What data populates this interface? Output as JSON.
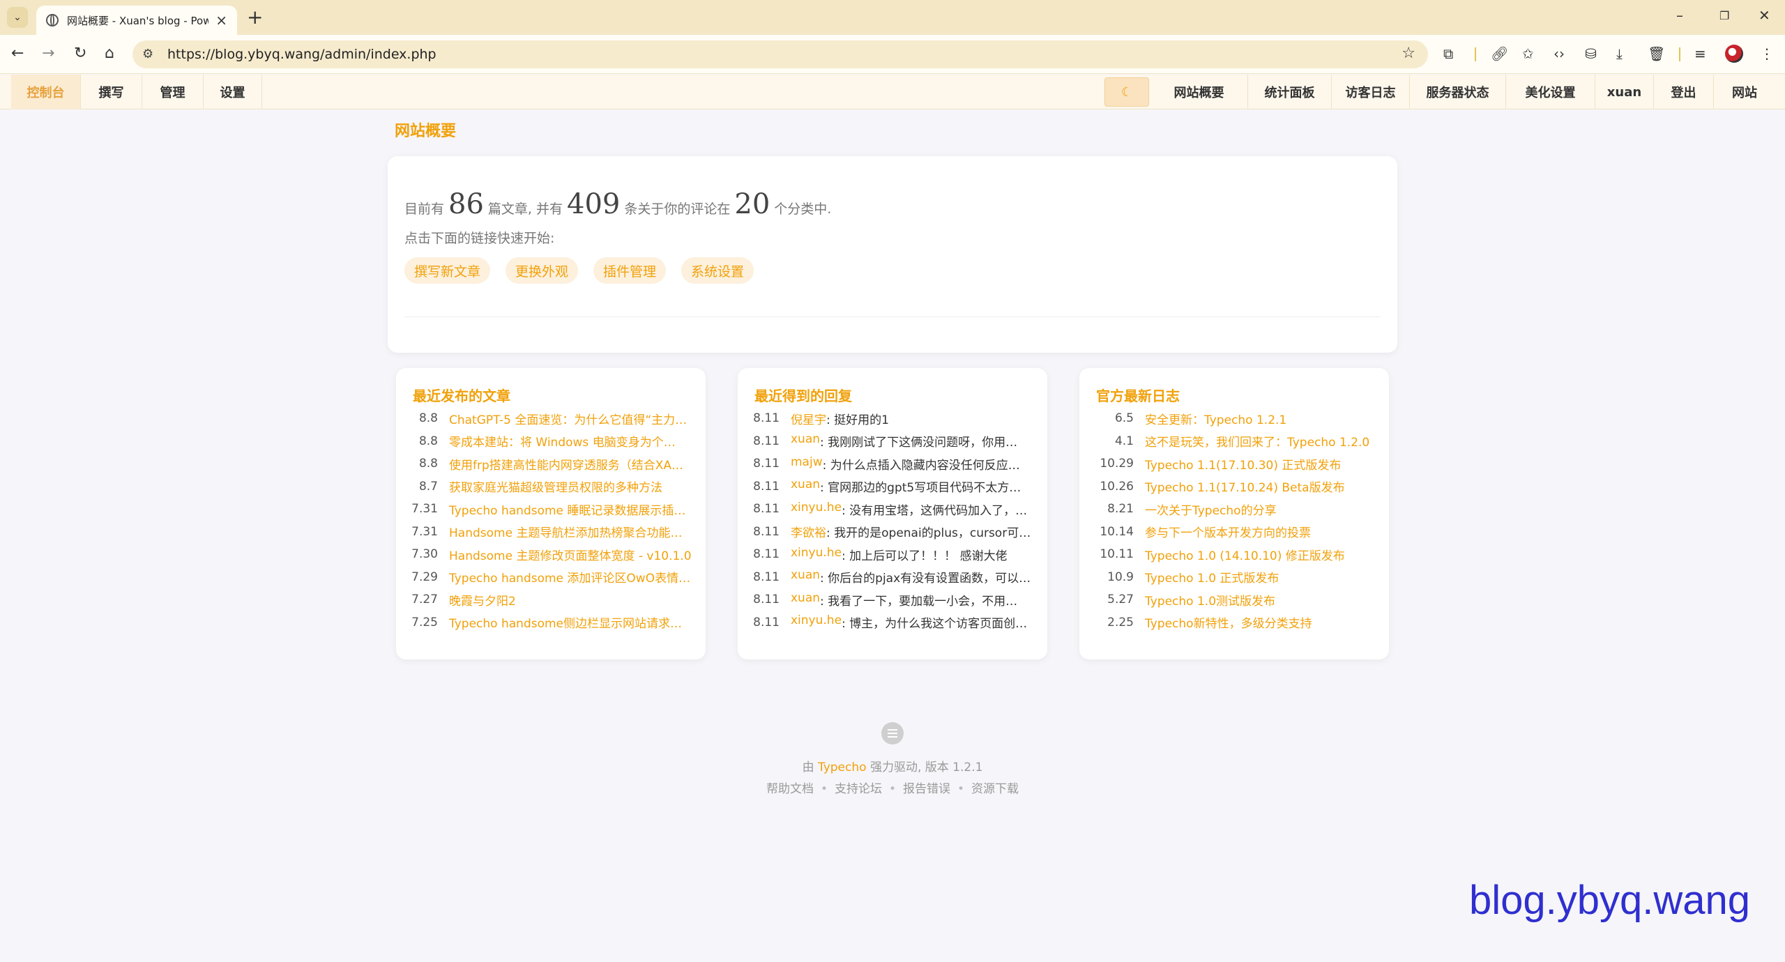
{
  "browser": {
    "tab_title": "网站概要 - Xuan's blog - Pow",
    "url": "https://blog.ybyq.wang/admin/index.php"
  },
  "admin_nav": {
    "left": [
      "控制台",
      "撰写",
      "管理",
      "设置"
    ],
    "active": "控制台",
    "right": [
      "网站概要",
      "统计面板",
      "访客日志",
      "服务器状态",
      "美化设置",
      "xuan",
      "登出",
      "网站"
    ]
  },
  "page_title": "网站概要",
  "welcome": {
    "stats_prefix": "目前有",
    "posts_count": "86",
    "stats_mid1": "篇文章, 并有",
    "comments_count": "409",
    "stats_mid2": "条关于你的评论在",
    "categories_count": "20",
    "stats_suffix": "个分类中.",
    "hint": "点击下面的链接快速开始:",
    "quick_links": [
      "撰写新文章",
      "更换外观",
      "插件管理",
      "系统设置"
    ]
  },
  "recent_posts": {
    "title": "最近发布的文章",
    "items": [
      {
        "date": "8.8",
        "title": "ChatGPT-5 全面速览：为什么它值得“主力…"
      },
      {
        "date": "8.8",
        "title": "零成本建站：将 Windows 电脑变身为个…"
      },
      {
        "date": "8.8",
        "title": "使用frp搭建高性能内网穿透服务（结合XA…"
      },
      {
        "date": "8.7",
        "title": "获取家庭光猫超级管理员权限的多种方法"
      },
      {
        "date": "7.31",
        "title": "Typecho handsome 睡眠记录数据展示插…"
      },
      {
        "date": "7.31",
        "title": "Handsome 主题导航栏添加热榜聚合功能…"
      },
      {
        "date": "7.30",
        "title": "Handsome 主题修改页面整体宽度 - v10.1.0"
      },
      {
        "date": "7.29",
        "title": "Typecho handsome 添加评论区OwO表情…"
      },
      {
        "date": "7.27",
        "title": "晚霞与夕阳2"
      },
      {
        "date": "7.25",
        "title": "Typecho handsome侧边栏显示网站请求…"
      }
    ]
  },
  "recent_comments": {
    "title": "最近得到的回复",
    "items": [
      {
        "date": "8.11",
        "author": "倪星宇",
        "text": ": 挺好用的1"
      },
      {
        "date": "8.11",
        "author": "xuan",
        "text": ": 我刚刚试了下这俩没问题呀，你用…"
      },
      {
        "date": "8.11",
        "author": "majw",
        "text": ": 为什么点插入隐藏内容没任何反应…"
      },
      {
        "date": "8.11",
        "author": "xuan",
        "text": ": 官网那边的gpt5写项目代码不太方…"
      },
      {
        "date": "8.11",
        "author": "xinyu.he",
        "text": ": 没有用宝塔，这俩代码加入了，…"
      },
      {
        "date": "8.11",
        "author": "李欲裕",
        "text": ": 我开的是openai的plus，cursor可…"
      },
      {
        "date": "8.11",
        "author": "xinyu.he",
        "text": ": 加上后可以了！！！ 感谢大佬"
      },
      {
        "date": "8.11",
        "author": "xuan",
        "text": ": 你后台的pjax有没有设置函数，可以…"
      },
      {
        "date": "8.11",
        "author": "xuan",
        "text": ": 我看了一下，要加载一小会，不用…"
      },
      {
        "date": "8.11",
        "author": "xinyu.he",
        "text": ": 博主，为什么我这个访客页面创…"
      }
    ]
  },
  "official_logs": {
    "title": "官方最新日志",
    "items": [
      {
        "date": "6.5",
        "title": "安全更新：Typecho 1.2.1"
      },
      {
        "date": "4.1",
        "title": "这不是玩笑，我们回来了：Typecho 1.2.0"
      },
      {
        "date": "10.29",
        "title": "Typecho 1.1(17.10.30) 正式版发布"
      },
      {
        "date": "10.26",
        "title": "Typecho 1.1(17.10.24) Beta版发布"
      },
      {
        "date": "8.21",
        "title": "一次关于Typecho的分享"
      },
      {
        "date": "10.14",
        "title": "参与下一个版本开发方向的投票"
      },
      {
        "date": "10.11",
        "title": "Typecho 1.0 (14.10.10) 修正版发布"
      },
      {
        "date": "10.9",
        "title": "Typecho 1.0 正式版发布"
      },
      {
        "date": "5.27",
        "title": "Typecho 1.0测试版发布"
      },
      {
        "date": "2.25",
        "title": "Typecho新特性，多级分类支持"
      }
    ]
  },
  "footer": {
    "powered_prefix": "由",
    "brand": "Typecho",
    "powered_suffix": "强力驱动, 版本 1.2.1",
    "links": [
      "帮助文档",
      "支持论坛",
      "报告错误",
      "资源下载"
    ]
  },
  "watermark": "blog.ybyq.wang",
  "colors": {
    "accent": "#f1a10b",
    "chrome": "#f3e7c6",
    "background": "#f6f5f9"
  }
}
